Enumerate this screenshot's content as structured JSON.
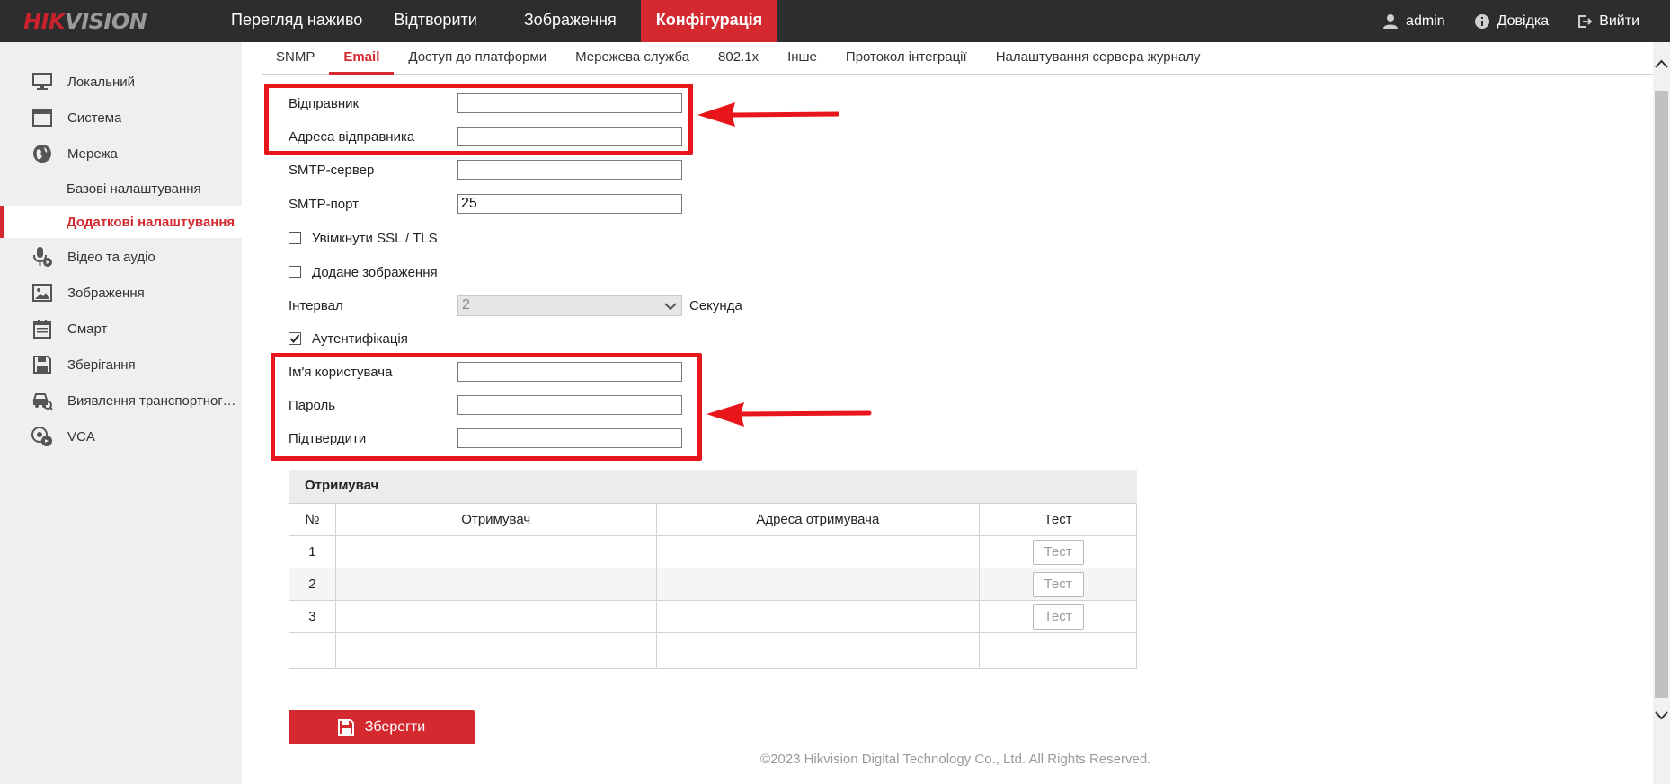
{
  "logo": {
    "part1": "HIK",
    "part2": "VISION"
  },
  "main_nav": [
    {
      "label": "Перегляд наживо",
      "active": false
    },
    {
      "label": "Відтворити",
      "active": false
    },
    {
      "label": "Зображення",
      "active": false
    },
    {
      "label": "Конфігурація",
      "active": true
    }
  ],
  "user_nav": {
    "user": "admin",
    "help": "Довідка",
    "logout": "Вийти"
  },
  "sidebar": {
    "items": [
      {
        "label": "Локальний",
        "icon": "monitor-icon"
      },
      {
        "label": "Система",
        "icon": "system-icon"
      },
      {
        "label": "Мережа",
        "icon": "globe-icon"
      },
      {
        "label": "Відео та аудіо",
        "icon": "mic-icon"
      },
      {
        "label": "Зображення",
        "icon": "image-icon"
      },
      {
        "label": "Смарт",
        "icon": "calendar-icon"
      },
      {
        "label": "Зберігання",
        "icon": "storage-icon"
      },
      {
        "label": "Виявлення транспортного засобу",
        "icon": "vehicle-icon"
      },
      {
        "label": "VCA",
        "icon": "vca-icon"
      }
    ],
    "sub_items": [
      {
        "label": "Базові налаштування",
        "active": false
      },
      {
        "label": "Додаткові налаштування",
        "active": true
      }
    ]
  },
  "tabs": [
    {
      "label": "SNMP",
      "active": false
    },
    {
      "label": "Email",
      "active": true
    },
    {
      "label": "Доступ до платформи",
      "active": false
    },
    {
      "label": "Мережева служба",
      "active": false
    },
    {
      "label": "802.1x",
      "active": false
    },
    {
      "label": "Інше",
      "active": false
    },
    {
      "label": "Протокол інтеграції",
      "active": false
    },
    {
      "label": "Налаштування сервера журналу",
      "active": false
    }
  ],
  "form": {
    "sender_label": "Відправник",
    "sender_value": "",
    "sender_address_label": "Адреса відправника",
    "sender_address_value": "",
    "smtp_server_label": "SMTP-сервер",
    "smtp_server_value": "",
    "smtp_port_label": "SMTP-порт",
    "smtp_port_value": "25",
    "ssl_label": "Увімкнути SSL / TLS",
    "ssl_checked": false,
    "attach_label": "Додане зображення",
    "attach_checked": false,
    "interval_label": "Інтервал",
    "interval_value": "2",
    "interval_unit": "Секунда",
    "auth_label": "Аутентифікація",
    "auth_checked": true,
    "username_label": "Ім'я користувача",
    "username_value": "",
    "password_label": "Пароль",
    "password_value": "",
    "confirm_label": "Підтвердити",
    "confirm_value": ""
  },
  "recipients": {
    "title": "Отримувач",
    "headers": {
      "no": "№",
      "name": "Отримувач",
      "address": "Адреса отримувача",
      "test": "Тест"
    },
    "rows": [
      {
        "no": "1",
        "name": "",
        "address": "",
        "test": "Тест"
      },
      {
        "no": "2",
        "name": "",
        "address": "",
        "test": "Тест"
      },
      {
        "no": "3",
        "name": "",
        "address": "",
        "test": "Тест"
      }
    ]
  },
  "save_label": "Зберегти",
  "footer": "©2023 Hikvision Digital Technology Co., Ltd. All Rights Reserved.",
  "colors": {
    "brand_red": "#d42a2f",
    "annotation_red": "#e8151a",
    "topbar": "#2d2d2d"
  }
}
